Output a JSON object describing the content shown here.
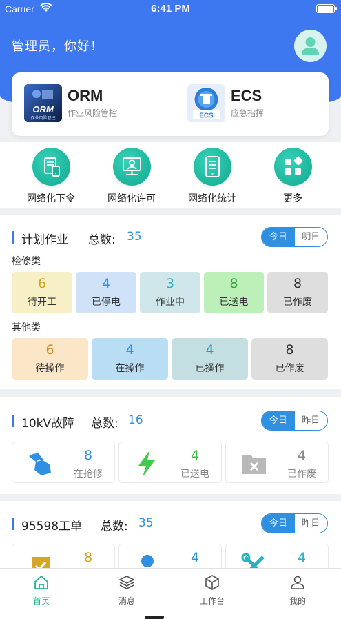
{
  "status": {
    "carrier": "Carrier",
    "time": "6:41 PM"
  },
  "header": {
    "greeting": "管理员，你好！"
  },
  "apps": [
    {
      "name": "ORM",
      "subtitle": "作业风险管控",
      "logo_text": "ORM",
      "logo_sub": "作业风险管控"
    },
    {
      "name": "ECS",
      "subtitle": "应急指挥",
      "logo_text": "ECS"
    }
  ],
  "quick_actions": [
    {
      "label": "网络化下令",
      "icon": "document-phone-icon"
    },
    {
      "label": "网络化许可",
      "icon": "person-monitor-icon"
    },
    {
      "label": "网络化统计",
      "icon": "phone-list-icon"
    },
    {
      "label": "更多",
      "icon": "grid-more-icon"
    }
  ],
  "planned": {
    "title": "计划作业",
    "count_label": "总数:",
    "count": "35",
    "toggle": [
      "今日",
      "明日"
    ],
    "group1_label": "检修类",
    "group1": [
      {
        "value": "6",
        "label": "待开工",
        "bg": "#f7efc6",
        "color": "#d4a017"
      },
      {
        "value": "4",
        "label": "已停电",
        "bg": "#cfe2f8",
        "color": "#2f8fe0"
      },
      {
        "value": "3",
        "label": "作业中",
        "bg": "#cfe7ea",
        "color": "#2ab1c0"
      },
      {
        "value": "8",
        "label": "已送电",
        "bg": "#bdf0b9",
        "color": "#2fa83a"
      },
      {
        "value": "8",
        "label": "已作废",
        "bg": "#dedede",
        "color": "#333333"
      }
    ],
    "group2_label": "其他类",
    "group2": [
      {
        "value": "6",
        "label": "待操作",
        "bg": "#fbe7c8",
        "color": "#d88a1e"
      },
      {
        "value": "4",
        "label": "在操作",
        "bg": "#b9def4",
        "color": "#2f8fe0"
      },
      {
        "value": "4",
        "label": "已操作",
        "bg": "#c3dfe2",
        "color": "#2a9aa8"
      },
      {
        "value": "8",
        "label": "已作废",
        "bg": "#dedede",
        "color": "#333333"
      }
    ]
  },
  "fault": {
    "title": "10kV故障",
    "count_label": "总数:",
    "count": "16",
    "toggle": [
      "今日",
      "昨日"
    ],
    "items": [
      {
        "value": "8",
        "label": "在抢修",
        "color": "#2f8fe0",
        "icon": "repair-hand-icon"
      },
      {
        "value": "4",
        "label": "已送电",
        "color": "#3fb84a",
        "icon": "lightning-icon"
      },
      {
        "value": "4",
        "label": "已作废",
        "color": "#888888",
        "icon": "void-folder-icon"
      }
    ]
  },
  "orders": {
    "title": "95598工单",
    "count_label": "总数:",
    "count": "35",
    "toggle": [
      "今日",
      "昨日"
    ],
    "items": [
      {
        "value": "8",
        "color": "#d4a017",
        "icon": "checkbox-icon"
      },
      {
        "value": "4",
        "color": "#2f8fe0",
        "icon": "person-icon"
      },
      {
        "value": "4",
        "color": "#2ab1c0",
        "icon": "tools-icon"
      }
    ]
  },
  "tabbar": [
    {
      "label": "首页",
      "icon": "home-icon"
    },
    {
      "label": "消息",
      "icon": "layers-icon"
    },
    {
      "label": "工作台",
      "icon": "box-icon"
    },
    {
      "label": "我的",
      "icon": "user-icon"
    }
  ],
  "colors": {
    "primary": "#3d78f0",
    "accent": "#2f8fe0",
    "active_tab": "#23b08e"
  }
}
